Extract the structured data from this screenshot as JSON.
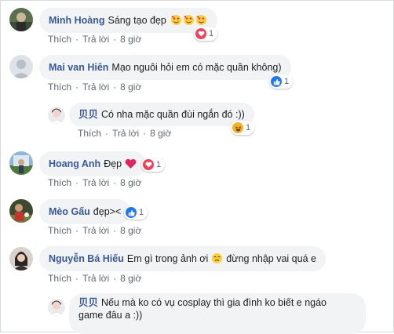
{
  "comments": [
    {
      "name": "Minh Hoàng",
      "text": "Sáng tạo đẹp",
      "reaction_count": "1",
      "like": "Thích",
      "reply": "Trả lời",
      "time": "8 giờ",
      "reaction": "heart"
    },
    {
      "name": "Mai van Hiên",
      "text": "Mạo nguôi hỏi em có mặc quần không)",
      "reaction_count": "1",
      "like": "Thích",
      "reply": "Trả lời",
      "time": "8 giờ",
      "reaction": "like"
    },
    {
      "name": "贝贝",
      "text": "Có nha mặc quần đùi ngắn đó :))",
      "reaction_count": "1",
      "like": "Thích",
      "reply": "Trả lời",
      "time": "8 giờ",
      "reaction": "haha"
    },
    {
      "name": "Hoang Anh",
      "text": "Đẹp",
      "reaction_count": "1",
      "like": "Thích",
      "reply": "Trả lời",
      "time": "8 giờ",
      "reaction": "heart"
    },
    {
      "name": "Mèo Gấu",
      "text": "đẹp><",
      "reaction_count": "1",
      "like": "Thích",
      "reply": "Trả lời",
      "time": "8 giờ",
      "reaction": "like"
    },
    {
      "name": "Nguyễn Bá Hiếu",
      "text_before": "Em gì trong ảnh ơi",
      "text_after": "đừng nhập vai quá e",
      "like": "Thích",
      "reply": "Trả lời",
      "time": "8 giờ"
    },
    {
      "name": "贝贝",
      "line1": "Nếu mà ko có vụ cosplay thì gia đình ko biết e ngáo",
      "line2": "game đâu a :))"
    }
  ],
  "separator": "·",
  "colors": {
    "name": "#385898",
    "bubble": "#f2f3f5",
    "meta": "#606770",
    "heart": "#f33e58",
    "like": "#2078f4",
    "haha": "#f7b125"
  }
}
